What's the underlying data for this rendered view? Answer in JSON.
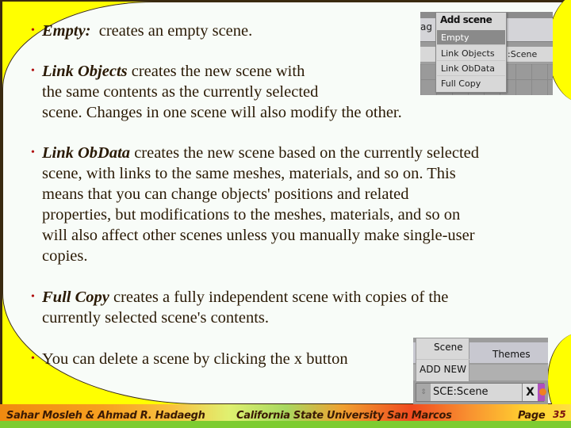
{
  "slide": {
    "bullets": [
      {
        "term": "Empty:",
        "text": "  creates an empty scene."
      },
      {
        "term": "Link Objects",
        "lines": [
          " creates the new scene with",
          "the same contents as the currently selected",
          "scene. Changes in one scene will also modify the other."
        ]
      },
      {
        "term": "Link ObData",
        "lines": [
          " creates the new scene based on the currently selected",
          "scene, with links to the same meshes, materials, and so on. This",
          "means that you can change objects' positions and related",
          "properties, but modifications to the meshes, materials, and so on",
          "will also affect other scenes unless you manually make single-user",
          "copies."
        ]
      },
      {
        "term": "Full Copy",
        "lines": [
          " creates a fully independent scene with copies of the",
          "currently selected scene's contents."
        ]
      },
      {
        "text": "You can delete a scene by clicking the x button"
      }
    ],
    "bullet_glyph": "•"
  },
  "add_scene_menu": {
    "partial_label": "ag",
    "scene_label": ":Scene",
    "title": "Add scene",
    "items": [
      "Empty",
      "Link Objects",
      "Link ObData",
      "Full Copy"
    ],
    "selected": "Empty"
  },
  "scene_panel": {
    "popup_title": "Scene",
    "popup_item": "ADD NEW",
    "tab_themes": "Themes",
    "spinner_glyph": "⇕",
    "scene_name": "SCE:Scene",
    "delete_glyph": "X"
  },
  "footer": {
    "authors": "Sahar Mosleh & Ahmad R. Hadaegh",
    "university": "California State University San Marcos",
    "page_label": "Page",
    "page_number": "35"
  },
  "colors": {
    "bullet": "#b01010",
    "text": "#2a1a05",
    "accent_yellow": "#ffff00",
    "footer_green": "#7dcc30"
  }
}
